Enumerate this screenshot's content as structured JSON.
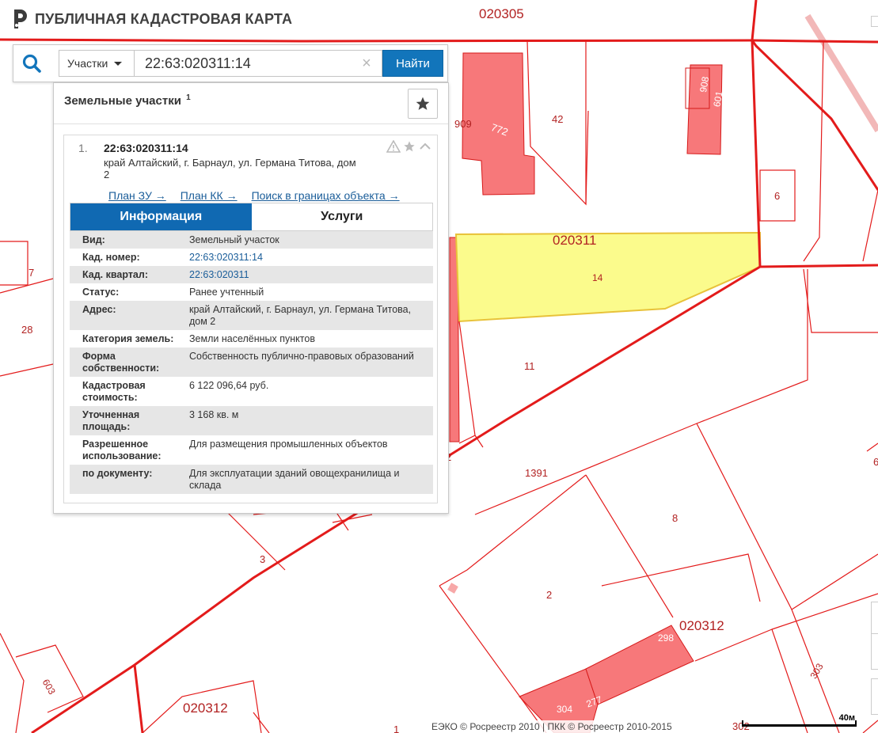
{
  "app": {
    "title": "ПУБЛИЧНАЯ КАДАСТРОВАЯ КАРТА"
  },
  "search": {
    "type_label": "Участки",
    "value": "22:63:020311:14",
    "clear_symbol": "×",
    "submit_label": "Найти"
  },
  "results": {
    "title": "Земельные участки",
    "count": "1",
    "items": [
      {
        "num": "1.",
        "id": "22:63:020311:14",
        "address": "край Алтайский, г. Барнаул, ул. Германа Титова, дом 2",
        "links": [
          "План ЗУ →",
          "План КК →",
          "Поиск в границах объекта →"
        ]
      }
    ]
  },
  "tabs": {
    "info": "Информация",
    "services": "Услуги"
  },
  "info_rows": [
    {
      "key": "Вид:",
      "value": "Земельный участок"
    },
    {
      "key": "Кад. номер:",
      "value": "22:63:020311:14"
    },
    {
      "key": "Кад. квартал:",
      "value": "22:63:020311"
    },
    {
      "key": "Статус:",
      "value": "Ранее учтенный"
    },
    {
      "key": "Адрес:",
      "value": "край Алтайский, г. Барнаул, ул. Германа Титова, дом 2"
    },
    {
      "key": "Категория земель:",
      "value": "Земли населённых пунктов"
    },
    {
      "key": "Форма собственности:",
      "value": "Собственность публично-правовых образований"
    },
    {
      "key": "Кадастровая стоимость:",
      "value": "6 122 096,64 руб."
    },
    {
      "key": "Уточненная площадь:",
      "value": "3 168 кв. м"
    },
    {
      "key": "Разрешенное использование:",
      "value": "Для размещения промышленных объектов"
    },
    {
      "key": "по документу:",
      "value": "Для эксплуатации зданий овощехранилища и склада"
    }
  ],
  "map": {
    "labels": {
      "q_020305": "020305",
      "q_020311": "020311",
      "q_020312a": "020312",
      "q_020312b": "020312",
      "p_909": "909",
      "p_772": "772",
      "p_42": "42",
      "p_908": "908",
      "p_601": "601",
      "p_6": "6",
      "p_7": "7",
      "p_28": "28",
      "p_14": "14",
      "p_11": "11",
      "p_1391": "1391",
      "p_8": "8",
      "p_3": "3",
      "p_2": "2",
      "p_298": "298",
      "p_277": "277",
      "p_304": "304",
      "p_303": "303",
      "p_603": "603",
      "p_1": "1",
      "p_302": "302",
      "p_6b": "6",
      "p_2b": "2"
    },
    "colors": {
      "boundary": "#e31b1b",
      "building_fill": "#f7787a",
      "selected_fill": "#fbfb8c",
      "selected_stroke": "#e8c23a",
      "label": "#b22222"
    }
  },
  "footer": {
    "copyright": "ЕЭКО © Росреестр 2010 | ПКК © Росреестр 2010-2015",
    "scale_label": "40м"
  }
}
